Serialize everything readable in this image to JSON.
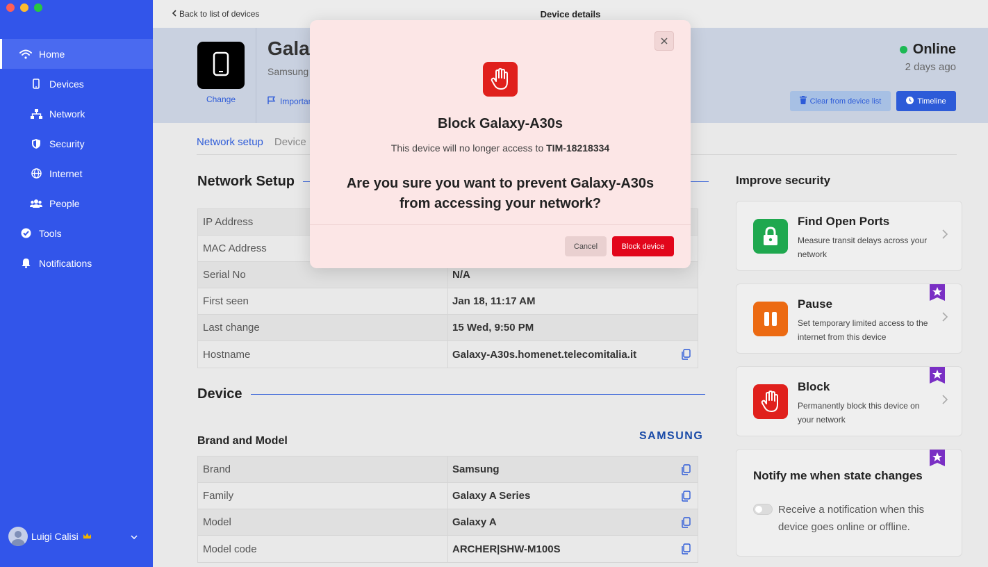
{
  "sidebar": {
    "items": [
      {
        "label": "Home",
        "icon": "wifi-icon"
      },
      {
        "label": "Devices",
        "icon": "phone-icon"
      },
      {
        "label": "Network",
        "icon": "network-icon"
      },
      {
        "label": "Security",
        "icon": "shield-icon"
      },
      {
        "label": "Internet",
        "icon": "globe-icon"
      },
      {
        "label": "People",
        "icon": "people-icon"
      },
      {
        "label": "Tools",
        "icon": "check-circle-icon"
      },
      {
        "label": "Notifications",
        "icon": "bell-icon"
      }
    ],
    "user": {
      "name": "Luigi Calisi",
      "badge": "crown-icon"
    }
  },
  "topbar": {
    "back_label": "Back to list of devices",
    "title": "Device details"
  },
  "device": {
    "name": "Galaxy-A30s",
    "brand": "Samsung",
    "change_label": "Change",
    "important_label": "Important",
    "status": "Online",
    "status_color": "#1db954",
    "last_seen": "2 days ago",
    "clear_label": "Clear from device list",
    "timeline_label": "Timeline"
  },
  "tabs": [
    "Network setup",
    "Device"
  ],
  "network_setup": {
    "title": "Network Setup",
    "rows": [
      {
        "key": "IP Address",
        "value": ""
      },
      {
        "key": "MAC Address",
        "value": ""
      },
      {
        "key": "Serial No",
        "value": "N/A"
      },
      {
        "key": "First seen",
        "value": "Jan 18, 11:17 AM"
      },
      {
        "key": "Last change",
        "value": "15 Wed, 9:50 PM"
      },
      {
        "key": "Hostname",
        "value": "Galaxy-A30s.homenet.telecomitalia.it"
      }
    ]
  },
  "device_section": {
    "title": "Device",
    "brand_model_title": "Brand and Model",
    "brand_logo": "SAMSUNG",
    "rows": [
      {
        "key": "Brand",
        "value": "Samsung"
      },
      {
        "key": "Family",
        "value": "Galaxy A Series"
      },
      {
        "key": "Model",
        "value": "Galaxy A"
      },
      {
        "key": "Model code",
        "value": "ARCHER|SHW-M100S"
      }
    ]
  },
  "improve": {
    "title": "Improve security",
    "cards": [
      {
        "title": "Find Open Ports",
        "desc": "Measure transit delays across your network",
        "color": "#1fa84f",
        "icon": "lock-icon"
      },
      {
        "title": "Pause",
        "desc": "Set temporary limited access to the internet from this device",
        "color": "#ec6a12",
        "icon": "pause-icon"
      },
      {
        "title": "Block",
        "desc": "Permanently block this device on your network",
        "color": "#e0201c",
        "icon": "hand-icon"
      }
    ],
    "notify": {
      "title": "Notify me when state changes",
      "text": "Receive a notification when this device goes online or offline."
    }
  },
  "modal": {
    "title": "Block Galaxy-A30s",
    "subtitle_prefix": "This device will no longer access to ",
    "network_name": "TIM-18218334",
    "question": "Are you sure you want to prevent Galaxy-A30s from accessing your network?",
    "cancel_label": "Cancel",
    "block_label": "Block device",
    "accent": "#e2061b"
  }
}
